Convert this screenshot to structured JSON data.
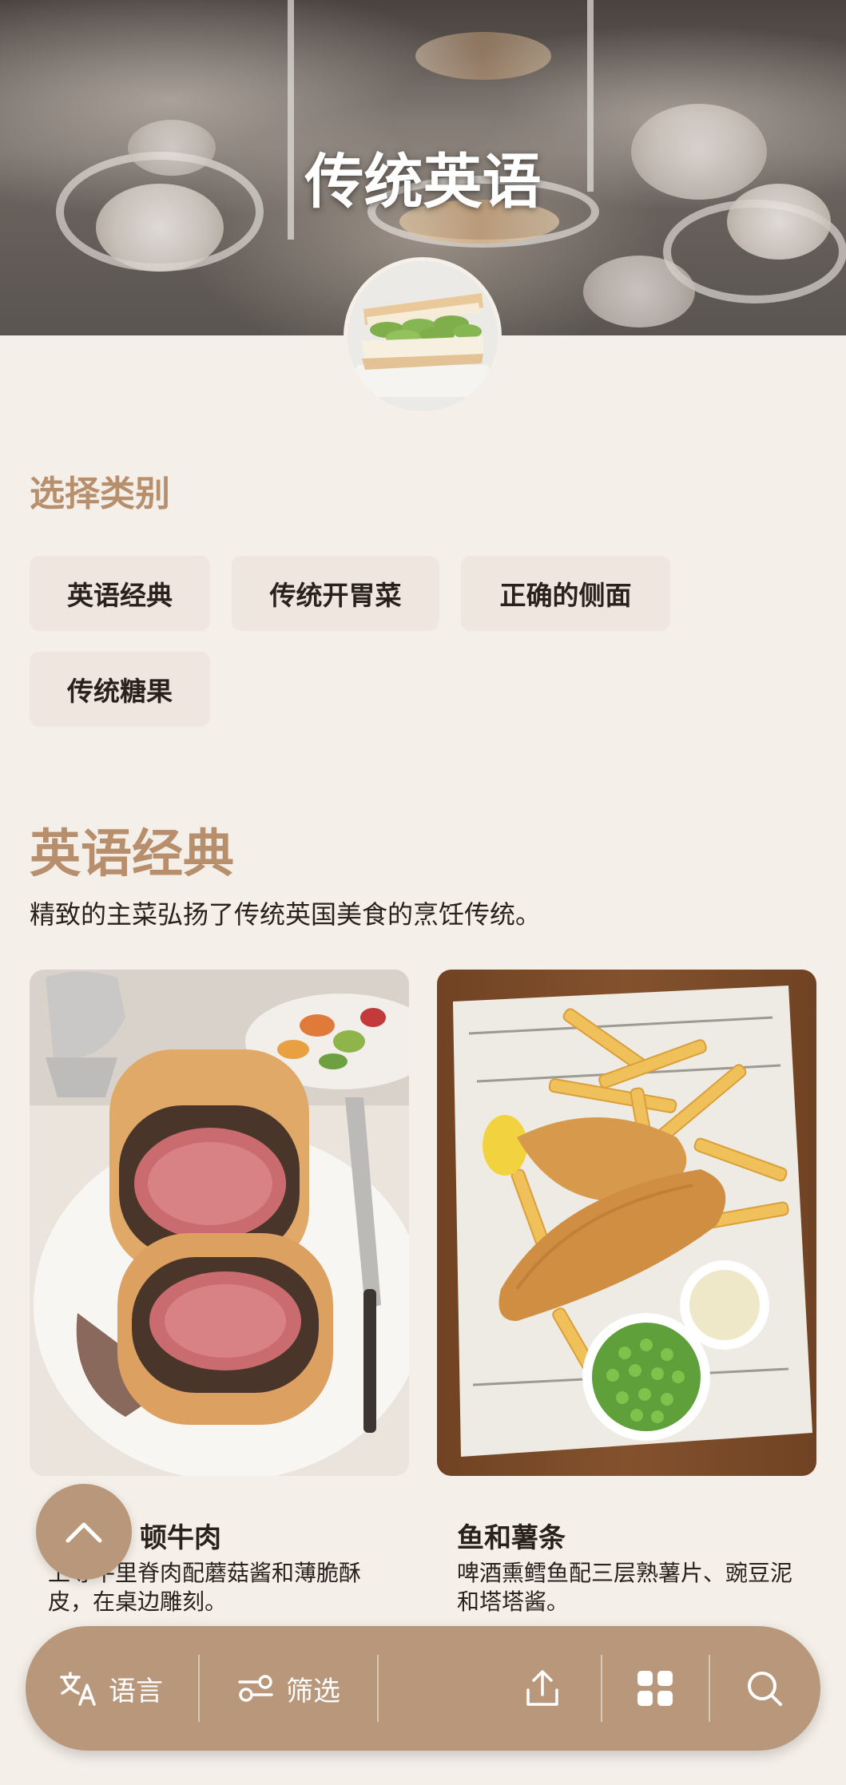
{
  "hero": {
    "title": "传统英语"
  },
  "categories_section": {
    "label": "选择类别",
    "chips": [
      "英语经典",
      "传统开胃菜",
      "正确的侧面",
      "传统糖果"
    ]
  },
  "category": {
    "title": "英语经典",
    "description": "精致的主菜弘扬了传统英国美食的烹饪传统。"
  },
  "cards": [
    {
      "title": "惠灵顿牛肉",
      "visible_title": "顿牛肉",
      "text": "上等牛里脊肉配蘑菇酱和薄脆酥皮，在桌边雕刻。"
    },
    {
      "title": "鱼和薯条",
      "text": "啤酒熏鳕鱼配三层熟薯片、豌豆泥和塔塔酱。"
    }
  ],
  "bottom_bar": {
    "language_label": "语言",
    "filter_label": "筛选",
    "icons": [
      "translate-icon",
      "filter-icon",
      "share-icon",
      "grid-icon",
      "search-icon"
    ]
  },
  "fab": {
    "icon": "chevron-up-icon"
  },
  "colors": {
    "accent": "#b8977a",
    "heading": "#b78f6c",
    "background": "#f5efe9",
    "chip": "#efe6df"
  }
}
